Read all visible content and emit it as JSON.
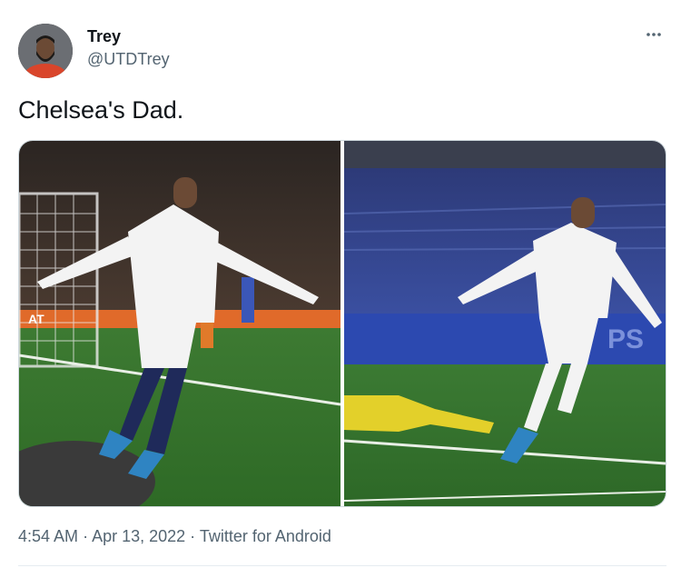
{
  "tweet": {
    "author": {
      "display_name": "Trey",
      "handle": "@UTDTrey",
      "avatar_icon": "user-avatar"
    },
    "text": "Chelsea's Dad.",
    "media": [
      {
        "name": "photo-left",
        "kind": "photo",
        "banner_text": "AT"
      },
      {
        "name": "photo-right",
        "kind": "photo",
        "banner_text": "PS"
      }
    ],
    "time": "4:54 AM",
    "separator": "·",
    "date": "Apr 13, 2022",
    "source": "Twitter for Android",
    "more_icon": "more-horizontal-icon"
  },
  "colors": {
    "text_primary": "#0f1419",
    "text_secondary": "#536471",
    "border": "#cfd9de"
  }
}
